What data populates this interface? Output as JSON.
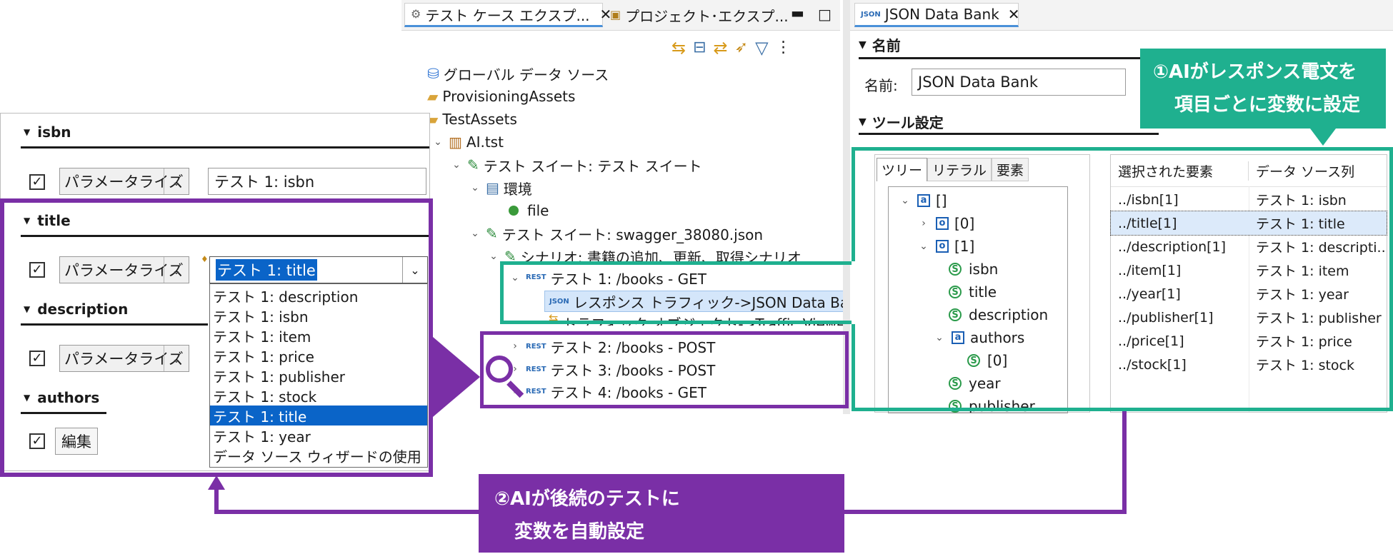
{
  "explorer": {
    "tabs": [
      {
        "label": "テスト ケース エクスプ..."
      },
      {
        "label": "プロジェクト･エクスプ..."
      }
    ],
    "tree": [
      {
        "label": "グローバル データ ソース"
      },
      {
        "label": "ProvisioningAssets"
      },
      {
        "label": "TestAssets"
      },
      {
        "label": "AI.tst"
      },
      {
        "label": "テスト スイート: テスト スイート"
      },
      {
        "label": "環境"
      },
      {
        "label": "file"
      },
      {
        "label": "テスト スイート: swagger_38080.json"
      },
      {
        "label": "シナリオ: 書籍の追加、更新、取得シナリオ"
      },
      {
        "label": "テスト 1: /books - GET"
      },
      {
        "label": "レスポンス トラフィック->JSON Data Bank"
      },
      {
        "label": "トラフィック オブジェクト->Traffic Viewer"
      },
      {
        "label": "テスト 2: /books - POST"
      },
      {
        "label": "テスト 3: /books - POST"
      },
      {
        "label": "テスト 4: /books - GET"
      }
    ],
    "rest_badge": "REST",
    "json_badge": "JSON"
  },
  "databank": {
    "tab_label": "JSON Data Bank",
    "section_name": "名前",
    "name_label": "名前:",
    "name_value": "JSON Data Bank",
    "section_tool": "ツール設定",
    "subtabs": [
      "ツリー",
      "リテラル",
      "要素"
    ],
    "tree": [
      {
        "label": "[]"
      },
      {
        "label": "[0]"
      },
      {
        "label": "[1]"
      },
      {
        "label": "isbn"
      },
      {
        "label": "title"
      },
      {
        "label": "description"
      },
      {
        "label": "authors"
      },
      {
        "label": "[0]"
      },
      {
        "label": "year"
      },
      {
        "label": "publisher"
      }
    ],
    "type_glyphs": {
      "array": "a",
      "object": "o",
      "string": "S"
    },
    "table": {
      "headers": [
        "選択された要素",
        "データ ソース列"
      ],
      "rows": [
        [
          "../isbn[1]",
          "テスト 1: isbn"
        ],
        [
          "../title[1]",
          "テスト 1: title"
        ],
        [
          "../description[1]",
          "テスト 1: descripti..."
        ],
        [
          "../item[1]",
          "テスト 1: item"
        ],
        [
          "../year[1]",
          "テスト 1: year"
        ],
        [
          "../publisher[1]",
          "テスト 1: publisher"
        ],
        [
          "../price[1]",
          "テスト 1: price"
        ],
        [
          "../stock[1]",
          "テスト 1: stock"
        ]
      ]
    }
  },
  "form": {
    "sections": [
      {
        "title": "isbn",
        "mode": "パラメータライズ",
        "value": "テスト 1: isbn"
      },
      {
        "title": "title",
        "mode": "パラメータライズ",
        "value": "テスト 1: title"
      },
      {
        "title": "description",
        "mode": "パラメータライズ"
      },
      {
        "title": "authors",
        "button": "編集"
      }
    ],
    "dropdown": [
      "テスト 1: description",
      "テスト 1: isbn",
      "テスト 1: item",
      "テスト 1: price",
      "テスト 1: publisher",
      "テスト 1: stock",
      "テスト 1: title",
      "テスト 1: year",
      "データ ソース ウィザードの使用"
    ],
    "dropdown_selected_index": 6
  },
  "callouts": {
    "c1_line1": "①AIがレスポンス電文を",
    "c1_line2": "項目ごとに変数に設定",
    "c2_line1": "②AIが後続のテストに",
    "c2_line2": "変数を自動設定"
  },
  "colors": {
    "teal": "#1fb08f",
    "purple": "#7a2fa6",
    "selection_blue": "#0a64c8",
    "tab_accent": "#4a90d9"
  }
}
